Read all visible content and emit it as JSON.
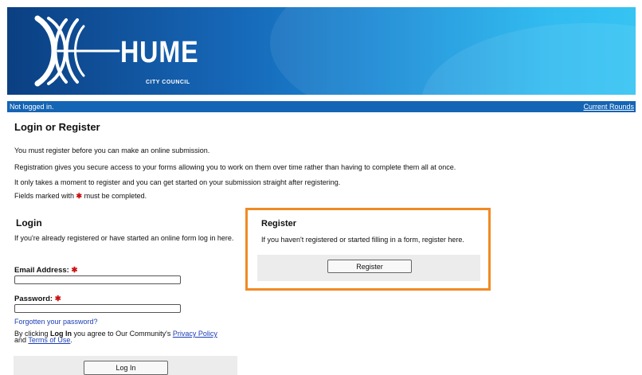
{
  "header": {
    "logo_word": "HUME",
    "logo_subtitle": "CITY COUNCIL",
    "brand_color": "#1565b5"
  },
  "statusbar": {
    "status_text": "Not logged in.",
    "current_rounds_link": "Current Rounds"
  },
  "page": {
    "title": "Login or Register",
    "intro_lines": [
      "You must register before you can make an online submission.",
      "Registration gives you secure access to your forms allowing you to work on them over time rather than having to complete them all at once.",
      "It only takes a moment to register and you can get started on your submission straight after registering."
    ],
    "required_note_before": "Fields marked with",
    "required_marker": "✱",
    "required_note_after": "must be completed."
  },
  "login": {
    "title": "Login",
    "intro": "If you're already registered or have started an online form log in here.",
    "email_label": "Email Address:",
    "email_value": "",
    "password_label": "Password:",
    "password_value": "",
    "forgot_link": "Forgotten your password?",
    "agree_prefix": "By clicking",
    "agree_bold": "Log In",
    "agree_middle": "you agree to Our Community's",
    "privacy_link": "Privacy Policy",
    "agree_and": "and",
    "terms_link": "Terms of Use",
    "agree_end": ".",
    "button_label": "Log In"
  },
  "register": {
    "title": "Register",
    "intro": "If you haven't registered or started filling in a form, register here.",
    "button_label": "Register",
    "highlight_color": "#f08a24"
  }
}
